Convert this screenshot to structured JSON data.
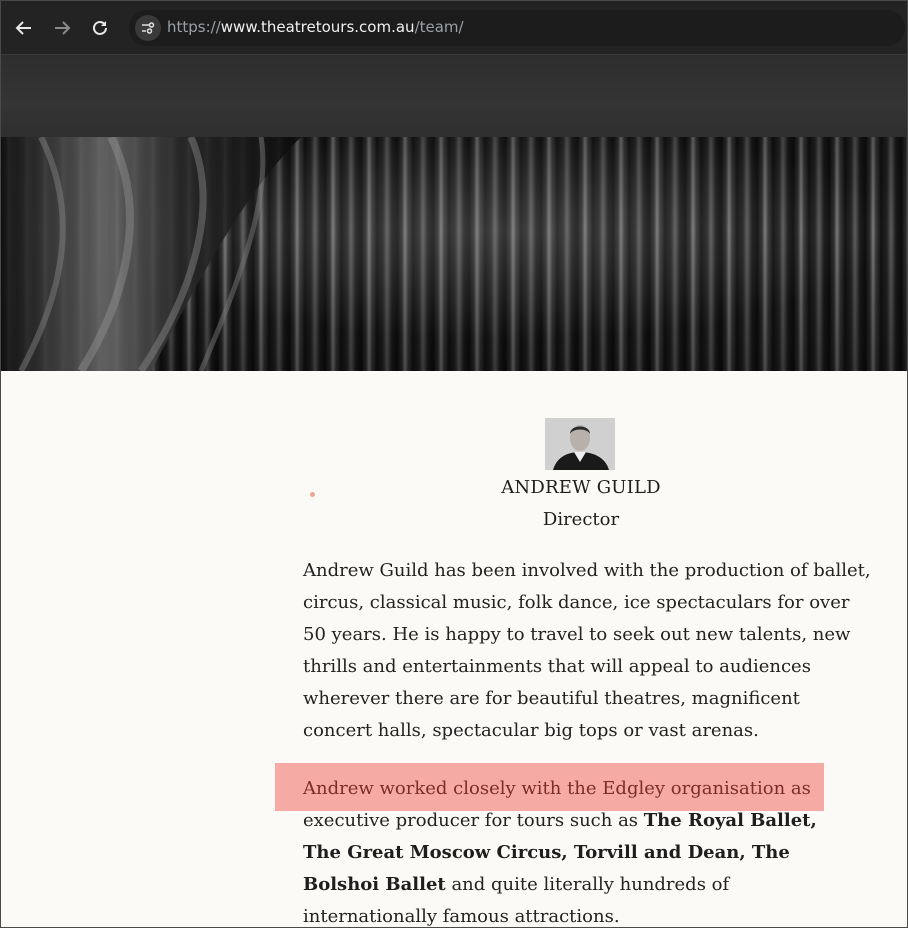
{
  "browser": {
    "url_scheme": "https://",
    "url_host": "www.theatretours.com.au",
    "url_path": "/team/",
    "icons": [
      "back-arrow-icon",
      "forward-arrow-icon",
      "reload-icon",
      "site-info-icon"
    ]
  },
  "profile": {
    "name": "ANDREW GUILD",
    "role": "Director",
    "bio_paragraph_1": "Andrew Guild has been involved with the production of ballet, circus, classical music, folk dance, ice spectaculars for over 50 years. He is happy to travel to seek out new talents, new thrills and entertainments that will appeal to audiences wherever there are for beautiful theatres, magnificent concert halls, spectacular big tops or vast arenas.",
    "bio_paragraph_2_highlighted": "Andrew worked closely with the Edgley organisation as",
    "bio_paragraph_2_mid": " executive producer for tours such as ",
    "bio_paragraph_2_bold": "The Royal Ballet, The Great Moscow Circus, Torvill and Dean, The Bolshoi Ballet",
    "bio_paragraph_2_end": " and quite literally hundreds of internationally famous attractions."
  },
  "colors": {
    "highlight": "#f6aaa4",
    "page_background": "#fcfaf6",
    "browser_chrome": "#232323"
  }
}
